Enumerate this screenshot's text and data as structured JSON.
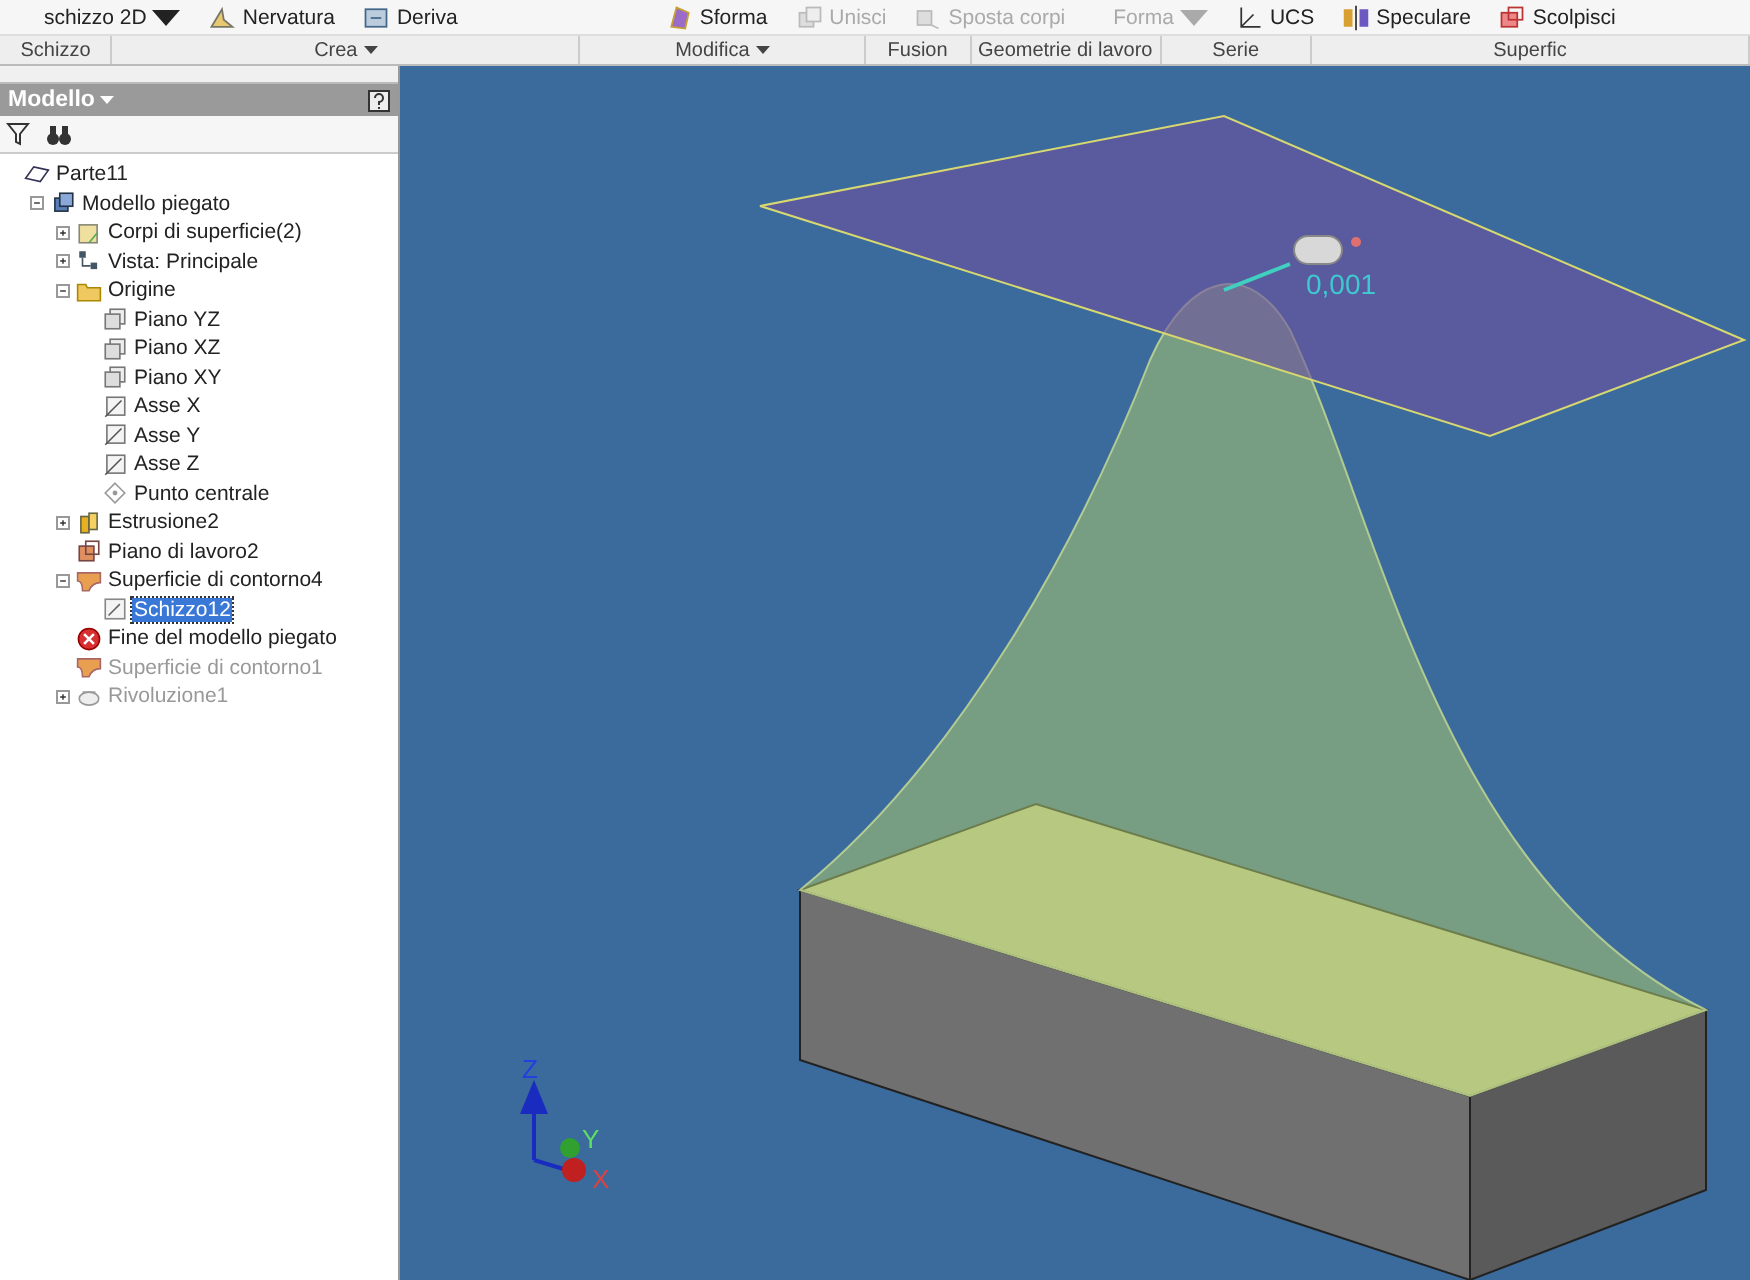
{
  "ribbon": {
    "buttons": [
      {
        "label": "schizzo 2D",
        "kind": "none",
        "disabled": false,
        "caret": true
      },
      {
        "label": "Nervatura",
        "kind": "rib",
        "disabled": false,
        "caret": false
      },
      {
        "label": "Deriva",
        "kind": "derive",
        "disabled": false,
        "caret": false
      },
      {
        "label": "Sforma",
        "kind": "draft",
        "disabled": false,
        "caret": false
      },
      {
        "label": "Unisci",
        "kind": "combine",
        "disabled": true,
        "caret": false
      },
      {
        "label": "Sposta corpi",
        "kind": "move",
        "disabled": true,
        "caret": false
      },
      {
        "label": "Forma",
        "kind": "none",
        "disabled": true,
        "caret": true
      },
      {
        "label": "UCS",
        "kind": "ucs",
        "disabled": false,
        "caret": false
      },
      {
        "label": "Speculare",
        "kind": "mirror",
        "disabled": false,
        "caret": false
      },
      {
        "label": "Scolpisci",
        "kind": "sculpt",
        "disabled": false,
        "caret": false
      }
    ],
    "panels": [
      {
        "label": "Schizzo",
        "caret": false
      },
      {
        "label": "Crea",
        "caret": true
      },
      {
        "label": "Modifica",
        "caret": true
      },
      {
        "label": "Fusion",
        "caret": false
      },
      {
        "label": "Geometrie di lavoro",
        "caret": false
      },
      {
        "label": "Serie",
        "caret": false
      },
      {
        "label": "Superfic",
        "caret": false
      }
    ]
  },
  "browser": {
    "title": "Modello",
    "tree": [
      {
        "label": "Parte11",
        "kind": "part",
        "disabled": false,
        "selected": false,
        "children": [
          {
            "label": "Modello piegato",
            "kind": "model",
            "disabled": false,
            "selected": false,
            "expanded": true,
            "children": [
              {
                "label": "Corpi di superficie(2)",
                "kind": "bodies",
                "disabled": false,
                "selected": false,
                "expanded": false
              },
              {
                "label": "Vista: Principale",
                "kind": "view",
                "disabled": false,
                "selected": false,
                "expanded": false
              },
              {
                "label": "Origine",
                "kind": "folder",
                "disabled": false,
                "selected": false,
                "expanded": true,
                "children": [
                  {
                    "label": "Piano YZ",
                    "kind": "plane",
                    "disabled": false,
                    "selected": false
                  },
                  {
                    "label": "Piano XZ",
                    "kind": "plane",
                    "disabled": false,
                    "selected": false
                  },
                  {
                    "label": "Piano XY",
                    "kind": "plane",
                    "disabled": false,
                    "selected": false
                  },
                  {
                    "label": "Asse X",
                    "kind": "axis",
                    "disabled": false,
                    "selected": false
                  },
                  {
                    "label": "Asse Y",
                    "kind": "axis",
                    "disabled": false,
                    "selected": false
                  },
                  {
                    "label": "Asse Z",
                    "kind": "axis",
                    "disabled": false,
                    "selected": false
                  },
                  {
                    "label": "Punto centrale",
                    "kind": "point",
                    "disabled": false,
                    "selected": false
                  }
                ]
              },
              {
                "label": "Estrusione2",
                "kind": "extrusion",
                "disabled": false,
                "selected": false,
                "expanded": false
              },
              {
                "label": "Piano di lavoro2",
                "kind": "workplane",
                "disabled": false,
                "selected": false
              },
              {
                "label": "Superficie di contorno4",
                "kind": "surface",
                "disabled": false,
                "selected": false,
                "expanded": true,
                "children": [
                  {
                    "label": "Schizzo12",
                    "kind": "sketch",
                    "disabled": false,
                    "selected": true
                  }
                ]
              },
              {
                "label": "Fine del modello piegato",
                "kind": "end",
                "disabled": false,
                "selected": false
              },
              {
                "label": "Superficie di contorno1",
                "kind": "surface",
                "disabled": true,
                "selected": false
              },
              {
                "label": "Rivoluzione1",
                "kind": "revolve",
                "disabled": true,
                "selected": false,
                "expanded": false
              }
            ]
          }
        ]
      }
    ]
  },
  "viewport": {
    "dimension": "0,001",
    "axes": [
      "Z",
      "Y",
      "X"
    ]
  }
}
